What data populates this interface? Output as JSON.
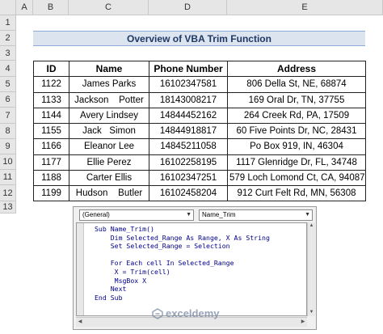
{
  "columns": [
    "A",
    "B",
    "C",
    "D",
    "E"
  ],
  "rows": [
    "1",
    "2",
    "3",
    "4",
    "5",
    "6",
    "7",
    "8",
    "9",
    "10",
    "11",
    "12",
    "13"
  ],
  "title": "Overview of VBA Trim Function",
  "table": {
    "headers": [
      "ID",
      "Name",
      "Phone Number",
      "Address"
    ],
    "rows": [
      [
        "1122",
        "James Parks",
        "16102347581",
        "806 Della St, NE, 68874"
      ],
      [
        "1133",
        "Jackson    Potter",
        "18143008217",
        "169 Oral Dr, TN, 37755"
      ],
      [
        "1144",
        "Avery Lindsey",
        "14844452162",
        "264 Creek Rd, PA, 17509"
      ],
      [
        "1155",
        "Jack   Simon",
        "14844918817",
        "60 Five Points Dr, NC, 28431"
      ],
      [
        "1166",
        "Eleanor Lee",
        "14845211058",
        "Po Box 919, IN, 46304"
      ],
      [
        "1177",
        "Ellie Perez",
        "16102258195",
        "1117 Glenridge Dr, FL, 34748"
      ],
      [
        "1188",
        "Carter Ellis",
        "16102347251",
        "579 Loch Lomond Ct, CA, 94087"
      ],
      [
        "1199",
        "Hudson    Butler",
        "16102458204",
        "912 Curt Felt Rd, MN, 56308"
      ]
    ]
  },
  "vba": {
    "object_combo": "(General)",
    "proc_combo": "Name_Trim",
    "code": "Sub Name_Trim()\n    Dim Selected_Range As Range, X As String\n    Set Selected_Range = Selection\n\n    For Each cell In Selected_Range\n     X = Trim(cell)\n     MsgBox X\n    Next\nEnd Sub"
  },
  "watermark": {
    "name": "exceldemy"
  }
}
